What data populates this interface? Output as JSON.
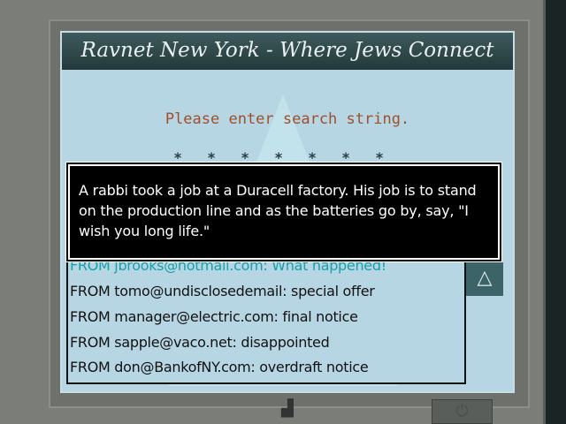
{
  "title": "Ravnet New York - Where Jews Connect",
  "prompt": "Please enter search string.",
  "stars": [
    "*",
    "*",
    "*",
    "*",
    "*",
    "*",
    "*"
  ],
  "emails": [
    "FROM jbrooks@hotmail.com: What happened!",
    "FROM tomo@undisclosedemail: special offer",
    "FROM manager@electric.com: final notice",
    "FROM sapple@vaco.net: disappointed",
    "FROM don@BankofNY.com: overdraft notice"
  ],
  "dialog": "A rabbi took a job at a Duracell factory. His job is to stand on the production line and as the batteries go by, say, \"I wish you long life.\"",
  "scroll_icon": "up-arrow-icon",
  "power_icon": "power-icon"
}
